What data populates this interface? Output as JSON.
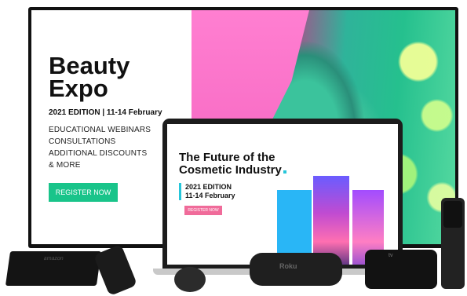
{
  "tv": {
    "title_line1": "Beauty",
    "title_line2": "Expo",
    "edition": "2021 EDITION | 11-14 February",
    "features": [
      "EDUCATIONAL WEBINARS",
      "CONSULTATIONS",
      "ADDITIONAL DISCOUNTS",
      "& MORE"
    ],
    "register_label": "REGISTER NOW"
  },
  "laptop": {
    "title_line1": "The Future of the",
    "title_line2": "Cosmetic Industry",
    "edition_line1": "2021 EDITION",
    "edition_line2": "11-14 February",
    "register_label": "REGISTER NOW"
  },
  "devices": {
    "firetv_logo": "amazon",
    "roku_logo": "Roku",
    "appletv_logo": "tv"
  },
  "colors": {
    "accent_green": "#19c48a",
    "accent_cyan": "#26c6da",
    "accent_pink": "#f06b9a"
  }
}
